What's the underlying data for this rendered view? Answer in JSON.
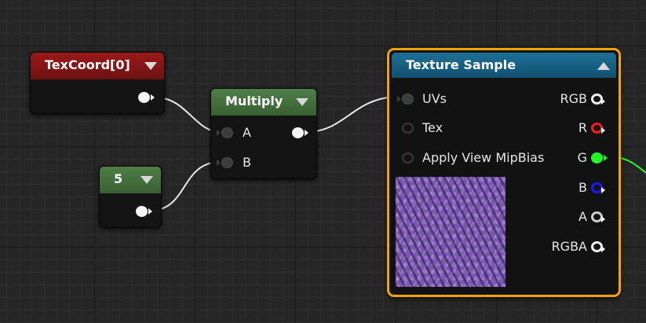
{
  "graph": {
    "nodes": {
      "texcoord": {
        "title": "TexCoord[0]",
        "header_color": "#8a1616"
      },
      "constant": {
        "title": "5",
        "header_color": "#4a7b41"
      },
      "multiply": {
        "title": "Multiply",
        "header_color": "#4a7b41",
        "inputs": [
          "A",
          "B"
        ]
      },
      "texture_sample": {
        "title": "Texture Sample",
        "header_color": "#176a93",
        "selected_outline_color": "#f2a20a",
        "inputs": [
          "UVs",
          "Tex",
          "Apply View MipBias"
        ],
        "outputs": [
          "RGB",
          "R",
          "G",
          "B",
          "A",
          "RGBA"
        ],
        "output_pin_colors": {
          "RGB": "#f0f0f0",
          "R": "#ff1a1a",
          "G": "#22ff22",
          "B": "#1a1aff",
          "A": "#cccccc",
          "RGBA": "#f0f0f0"
        }
      }
    },
    "connections": [
      "TexCoord[0] -> Multiply.A",
      "5 -> Multiply.B",
      "Multiply -> Texture Sample.UVs",
      "Texture Sample.G -> (offscreen)"
    ]
  }
}
